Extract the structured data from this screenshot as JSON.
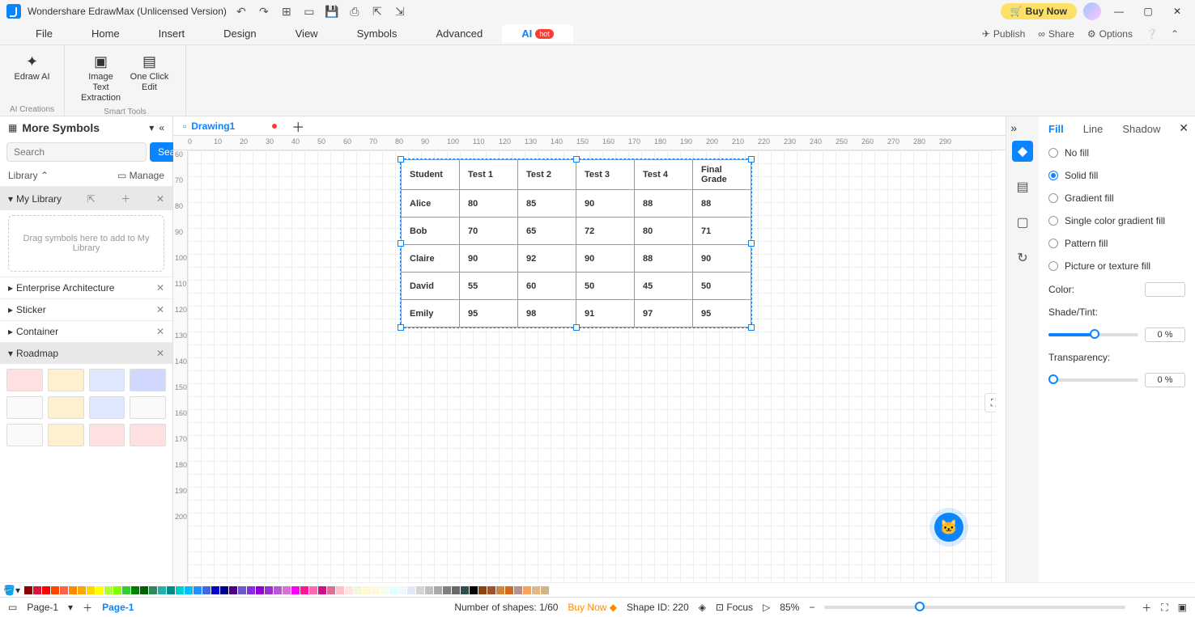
{
  "title": "Wondershare EdrawMax (Unlicensed Version)",
  "buy_now": "Buy Now",
  "menu": [
    "File",
    "Home",
    "Insert",
    "Design",
    "View",
    "Symbols",
    "Advanced"
  ],
  "menu_active": "AI",
  "hot": "hot",
  "menu_right": {
    "publish": "Publish",
    "share": "Share",
    "options": "Options"
  },
  "ribbon": {
    "g1": {
      "label": "AI Creations",
      "btn1": "Edraw\nAI"
    },
    "g2": {
      "label": "Smart Tools",
      "btn1": "Image Text\nExtraction",
      "btn2": "One Click\nEdit"
    }
  },
  "left": {
    "title": "More Symbols",
    "search_ph": "Search",
    "search_btn": "Search",
    "library": "Library",
    "manage": "Manage",
    "mylib": "My Library",
    "drop": "Drag symbols here to add to My Library",
    "sections": [
      "Enterprise Architecture",
      "Sticker",
      "Container",
      "Roadmap"
    ]
  },
  "doc_tab": "Drawing1",
  "ruler_h": [
    0,
    10,
    20,
    30,
    40,
    50,
    60,
    70,
    80,
    90,
    100,
    110,
    120,
    130,
    140,
    150,
    160,
    170,
    180,
    190,
    200,
    210,
    220,
    230,
    240,
    250,
    260,
    270,
    280,
    290
  ],
  "ruler_v": [
    60,
    70,
    80,
    90,
    100,
    110,
    120,
    130,
    140,
    150,
    160,
    170,
    180,
    190,
    200
  ],
  "table": {
    "header": [
      "Student",
      "Test 1",
      "Test 2",
      "Test 3",
      "Test 4",
      "Final Grade"
    ],
    "rows": [
      [
        "Alice",
        "80",
        "85",
        "90",
        "88",
        "88"
      ],
      [
        "Bob",
        "70",
        "65",
        "72",
        "80",
        "71"
      ],
      [
        "Claire",
        "90",
        "92",
        "90",
        "88",
        "90"
      ],
      [
        "David",
        "55",
        "60",
        "50",
        "45",
        "50"
      ],
      [
        "Emily",
        "95",
        "98",
        "91",
        "97",
        "95"
      ]
    ]
  },
  "right": {
    "tabs": [
      "Fill",
      "Line",
      "Shadow"
    ],
    "opts": [
      "No fill",
      "Solid fill",
      "Gradient fill",
      "Single color gradient fill",
      "Pattern fill",
      "Picture or texture fill"
    ],
    "color": "Color:",
    "shade": "Shade/Tint:",
    "trans": "Transparency:",
    "shade_val": "0 %",
    "trans_val": "0 %"
  },
  "colorbar": [
    "#8b0000",
    "#dc143c",
    "#ff0000",
    "#ff4500",
    "#ff6347",
    "#ff8c00",
    "#ffa500",
    "#ffd700",
    "#ffff00",
    "#adff2f",
    "#7fff00",
    "#32cd32",
    "#008000",
    "#006400",
    "#2e8b57",
    "#20b2aa",
    "#008b8b",
    "#00ced1",
    "#00bfff",
    "#1e90ff",
    "#4169e1",
    "#0000cd",
    "#00008b",
    "#4b0082",
    "#6a5acd",
    "#8a2be2",
    "#9400d3",
    "#9932cc",
    "#ba55d3",
    "#da70d6",
    "#ff00ff",
    "#ff1493",
    "#ff69b4",
    "#c71585",
    "#db7093",
    "#ffc0cb",
    "#ffe4e1",
    "#f5f5dc",
    "#fffacd",
    "#fff8dc",
    "#f0fff0",
    "#e0ffff",
    "#f0f8ff",
    "#e6e6fa",
    "#d3d3d3",
    "#c0c0c0",
    "#a9a9a9",
    "#808080",
    "#696969",
    "#2f4f4f",
    "#000000",
    "#8b4513",
    "#a0522d",
    "#cd853f",
    "#d2691e",
    "#bc8f8f",
    "#f4a460",
    "#deb887",
    "#d2b48c",
    "#ffffff"
  ],
  "status": {
    "page_sel": "Page-1",
    "page": "Page-1",
    "shapes": "Number of shapes: 1/60",
    "buy": "Buy Now",
    "shapeid": "Shape ID: 220",
    "focus": "Focus",
    "zoom": "85%"
  }
}
